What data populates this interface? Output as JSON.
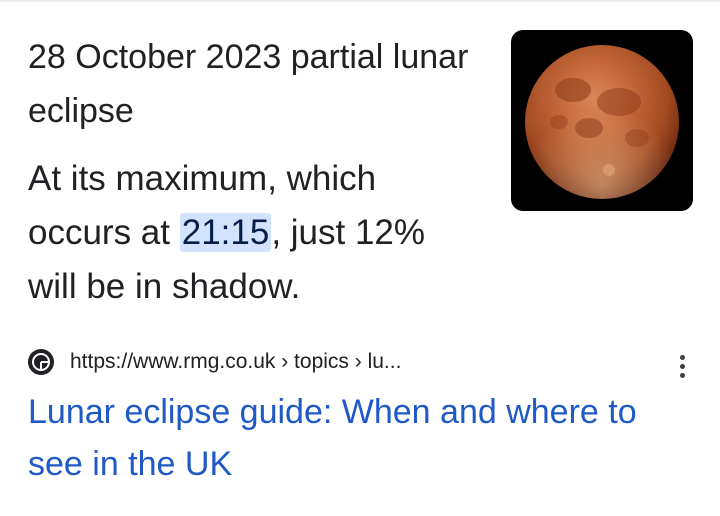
{
  "result": {
    "title": "28 October 2023 partial lunar eclipse",
    "snippet": {
      "before": "At its maximum, which occurs at ",
      "highlight": "21:15",
      "after": ", just 12% will be in shadow."
    },
    "thumbnail": {
      "alt": "lunar eclipse image"
    },
    "source": {
      "favicon": "rmg-favicon-icon",
      "url": "https://www.rmg.co.uk › topics › lu..."
    },
    "link_title": "Lunar eclipse guide: When and where to see in the UK"
  },
  "colors": {
    "link": "#1f59c8",
    "text": "#202124",
    "highlight_bg": "#d3e3fd"
  },
  "icons": {
    "menu": "more-vert-icon",
    "favicon": "rmg-favicon-icon"
  }
}
